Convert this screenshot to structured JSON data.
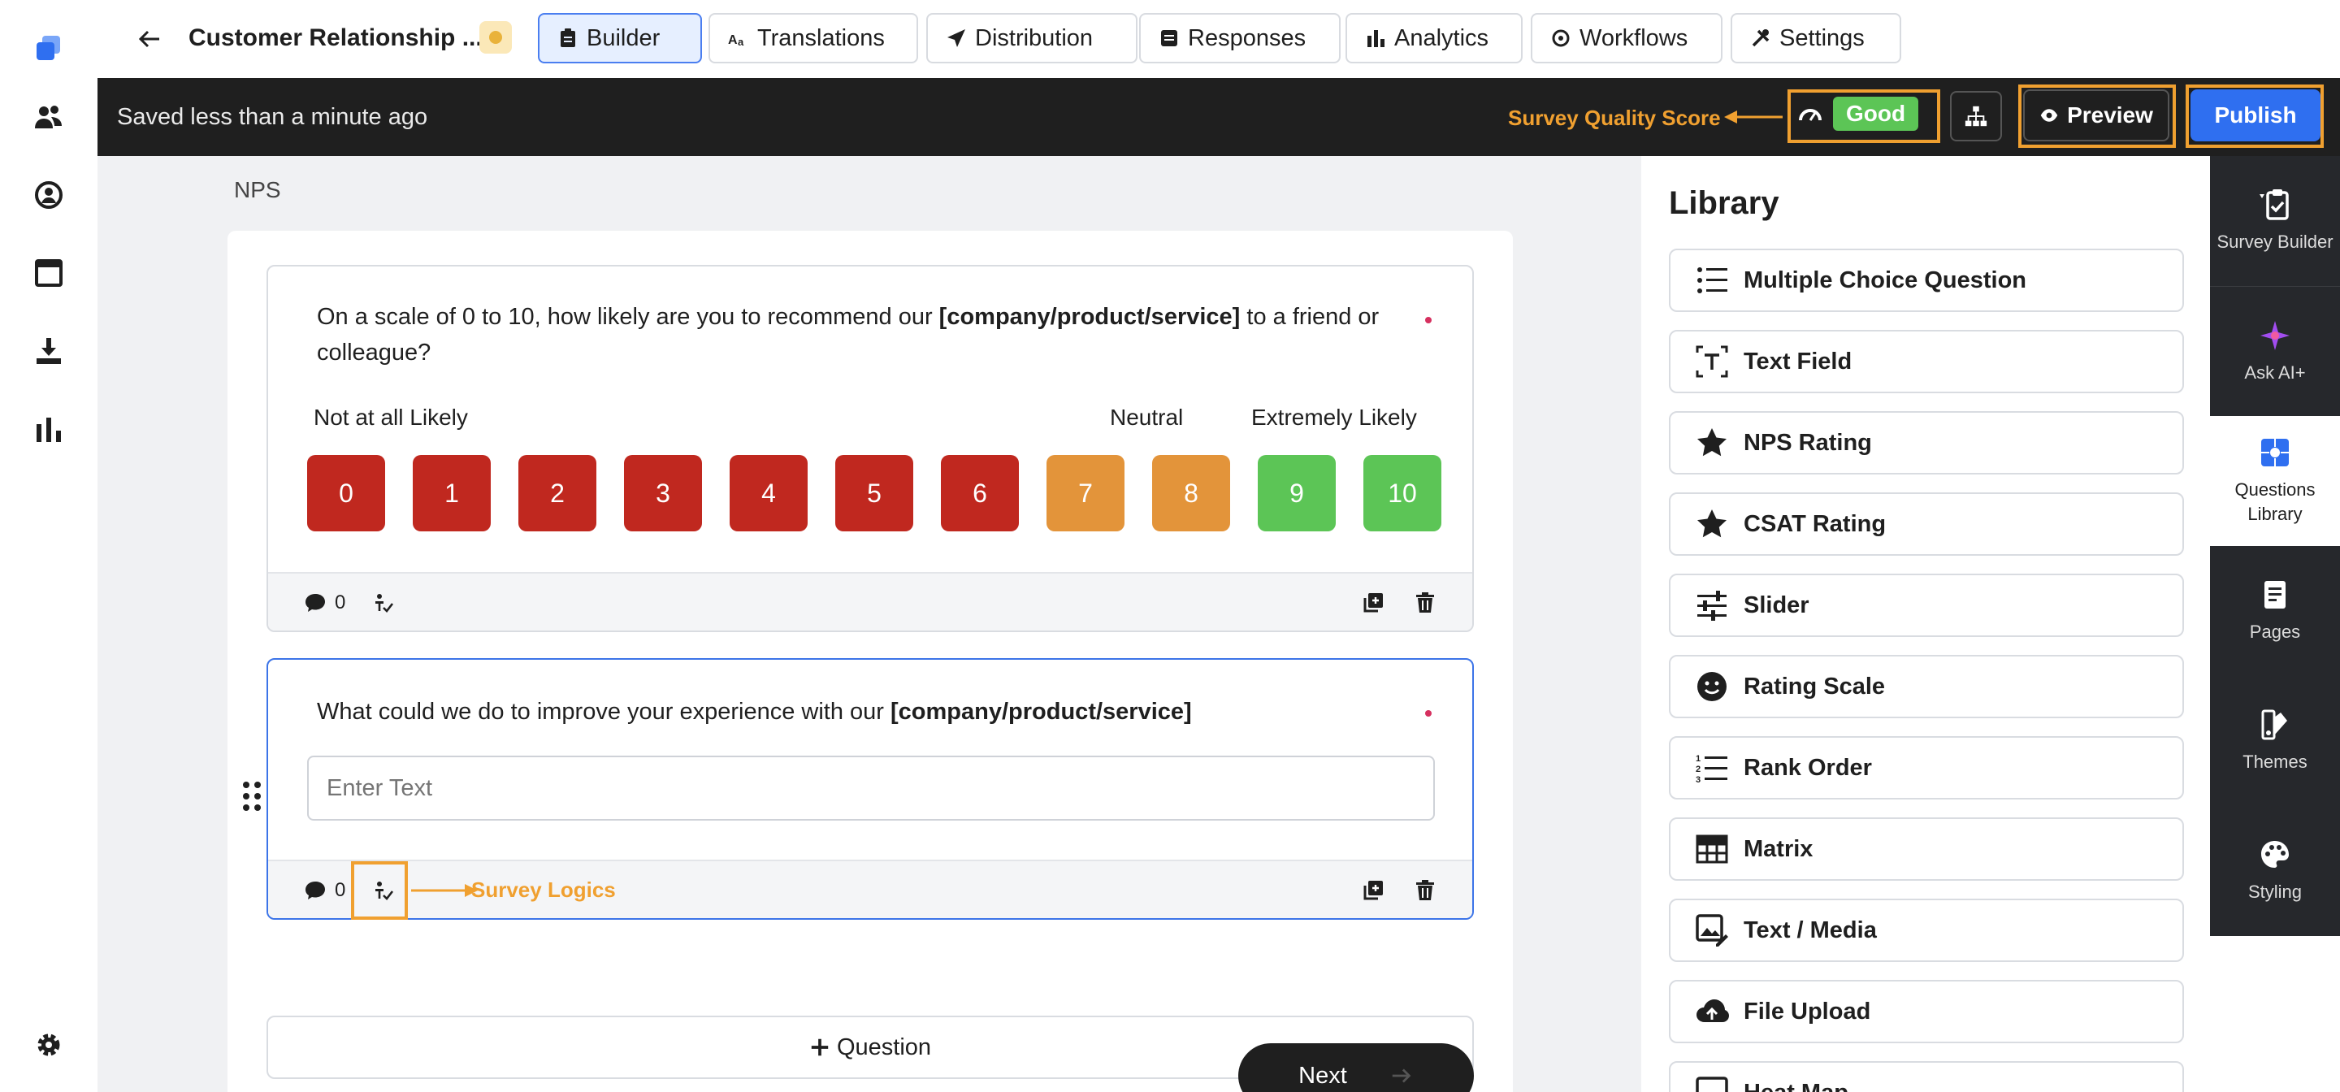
{
  "app": {
    "project_title": "Customer Relationship ...",
    "colors": {
      "accent": "#2f6ff0",
      "annotation": "#f0a030",
      "detractor": "#c0281f",
      "passive": "#e3943a",
      "promoter": "#5cc556"
    }
  },
  "rail": {
    "icons": [
      "app-logo-icon",
      "people-icon",
      "support-agent-icon",
      "browser-window-icon",
      "download-tray-icon",
      "bar-chart-icon",
      "gear-icon"
    ]
  },
  "tabs": [
    {
      "label": "Builder",
      "icon": "clipboard-icon",
      "active": true
    },
    {
      "label": "Translations",
      "icon": "translate-icon"
    },
    {
      "label": "Distribution",
      "icon": "send-icon"
    },
    {
      "label": "Responses",
      "icon": "list-icon"
    },
    {
      "label": "Analytics",
      "icon": "bar-chart-icon"
    },
    {
      "label": "Workflows",
      "icon": "workflow-icon"
    },
    {
      "label": "Settings",
      "icon": "tools-icon"
    }
  ],
  "toolbar": {
    "saved_status": "Saved less than a minute ago",
    "quality_annotation": "Survey Quality Score",
    "quality_value": "Good",
    "preview_label": "Preview",
    "publish_label": "Publish"
  },
  "builder": {
    "page_name": "NPS",
    "q1": {
      "text_before": "On a scale of 0 to 10, how likely are you to recommend our ",
      "text_bold": "[company/product/service]",
      "text_after": " to a friend or colleague?",
      "label_low": "Not at all Likely",
      "label_mid": "Neutral",
      "label_high": "Extremely Likely",
      "scale": [
        "0",
        "1",
        "2",
        "3",
        "4",
        "5",
        "6",
        "7",
        "8",
        "9",
        "10"
      ],
      "comment_count": "0"
    },
    "q2": {
      "text_before": "What could we do to improve your experience with our ",
      "text_bold": "[company/product/service]",
      "placeholder": "Enter Text",
      "comment_count": "0",
      "logic_annotation": "Survey Logics"
    },
    "add_question_label": "Question",
    "next_label": "Next"
  },
  "library": {
    "title": "Library",
    "items": [
      {
        "label": "Multiple Choice Question",
        "icon": "list-bullets-icon"
      },
      {
        "label": "Text Field",
        "icon": "text-field-icon"
      },
      {
        "label": "NPS Rating",
        "icon": "star-icon"
      },
      {
        "label": "CSAT Rating",
        "icon": "star-icon"
      },
      {
        "label": "Slider",
        "icon": "sliders-icon"
      },
      {
        "label": "Rating Scale",
        "icon": "smiley-icon"
      },
      {
        "label": "Rank Order",
        "icon": "numbered-list-icon"
      },
      {
        "label": "Matrix",
        "icon": "grid-icon"
      },
      {
        "label": "Text / Media",
        "icon": "media-icon"
      },
      {
        "label": "File Upload",
        "icon": "cloud-upload-icon"
      },
      {
        "label": "Heat Map",
        "icon": "heat-map-icon"
      }
    ]
  },
  "right_nav": [
    {
      "label": "Survey Builder",
      "icon": "clipboard-check-icon"
    },
    {
      "label": "Ask AI+",
      "icon": "sparkle-icon"
    },
    {
      "label": "Questions Library",
      "icon": "questions-library-icon",
      "active": true
    },
    {
      "label": "Pages",
      "icon": "pages-icon"
    },
    {
      "label": "Themes",
      "icon": "themes-icon"
    },
    {
      "label": "Styling",
      "icon": "palette-icon"
    }
  ]
}
